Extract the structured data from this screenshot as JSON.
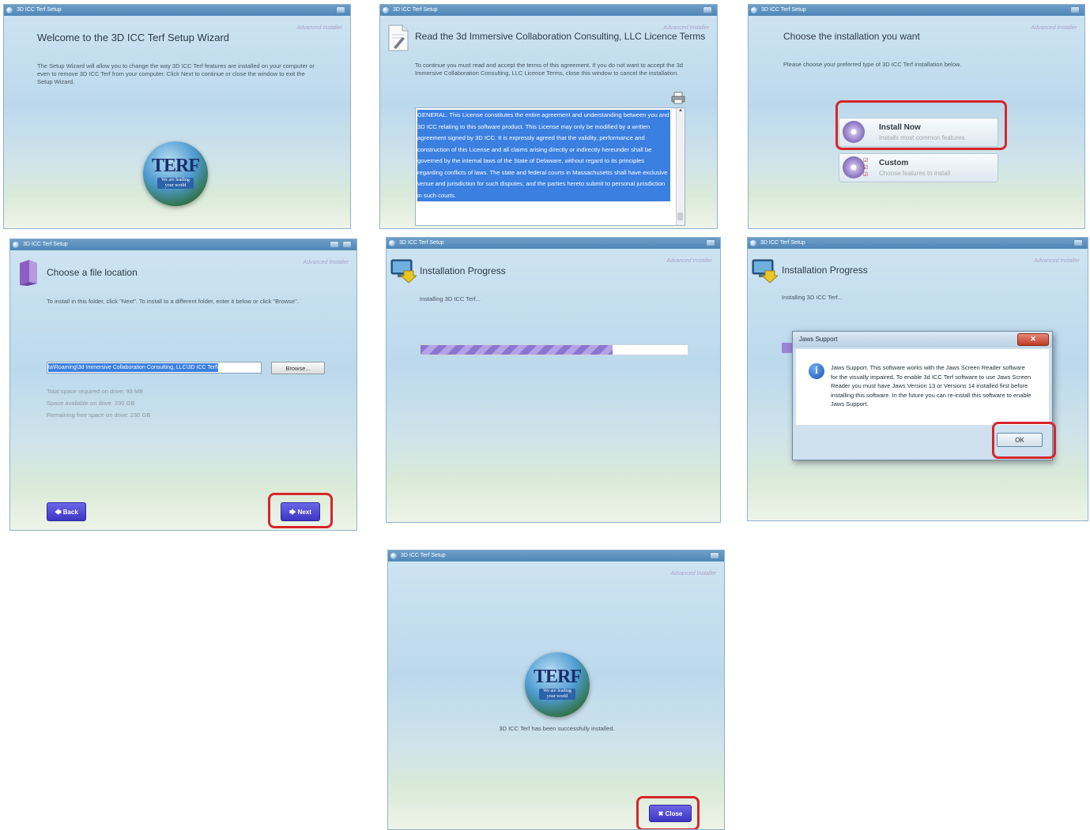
{
  "window_title": "3D ICC Terf Setup",
  "watermark": "Advanced Installer",
  "logo": {
    "word": "TERF",
    "tagline": "We are leading your world"
  },
  "panel1": {
    "heading": "Welcome to the 3D ICC Terf Setup Wizard",
    "text": "The Setup Wizard will allow you to change the way 3D ICC Terf features are installed on your computer or even to remove 3D ICC Terf from your computer. Click Next to continue or close the window to exit the Setup Wizard."
  },
  "panel2": {
    "heading": "Read the 3d Immersive Collaboration Consulting, LLC Licence Terms",
    "text": "To continue you must read and accept the terms of this agreement. If you do not want to accept the 3d Immersive Collaboration Consulting, LLC Licence Terms, close this window to cancel the installation.",
    "license": "GENERAL. This License constitutes the entire agreement and understanding between you and 3D ICC relating to this software product.  This License may only be modified by a written agreement signed by 3D ICC.  It is expressly agreed that the validity, performance and construction of this License and all claims arising directly or indirectly hereunder shall be governed by the internal laws of the State of Delaware, without regard to its principles regarding conflicts of laws.  The state and federal courts in Massachusetts shall have exclusive venue and jurisdiction for such disputes, and the parties hereto submit to personal jurisdiction in such courts."
  },
  "panel3": {
    "heading": "Choose the installation you want",
    "text": "Please choose your preferred type of 3D ICC Terf installation below.",
    "options": [
      {
        "title": "Install Now",
        "desc": "Installs most common features"
      },
      {
        "title": "Custom",
        "desc": "Choose features to install"
      }
    ]
  },
  "panel4": {
    "heading": "Choose a file location",
    "text": "To install in this folder, click \"Next\". To install to a different folder, enter it below or click \"Browse\".",
    "path": "ta\\Roaming\\3d Immersive Collaboration Consulting, LLC\\3D ICC Terf\\",
    "browse": "Browse...",
    "stats": [
      "Total space required on drive: 93 MB",
      "Space available on drive: 230 GB",
      "Remaining free space on drive: 230 GB"
    ],
    "back": "Back",
    "next": "Next"
  },
  "panel5": {
    "heading": "Installation Progress",
    "status": "Installing 3D ICC Terf...",
    "progress": 0.72
  },
  "panel6": {
    "heading": "Installation Progress",
    "status": "Installing 3D ICC Terf...",
    "dialog_title": "Jaws Support",
    "dialog_text": "Jaws Support.  This software works with the Jaws Screen Reader software for the visually impaired.  To enable 3d ICC Terf software to use Jaws Screen Reader you must have Jaws Version 13 or Versions 14 installed first before installing this software.  In the future you can re-install this software to enable Jaws Support.",
    "ok": "OK"
  },
  "panel7": {
    "message": "3D ICC Terf has been successfully installed.",
    "close": "Close"
  },
  "colors": {
    "accent_button": "#4a43d6",
    "highlight_box": "#d6262b",
    "selection": "#3b7fe0",
    "progress": "#9b86d6"
  }
}
